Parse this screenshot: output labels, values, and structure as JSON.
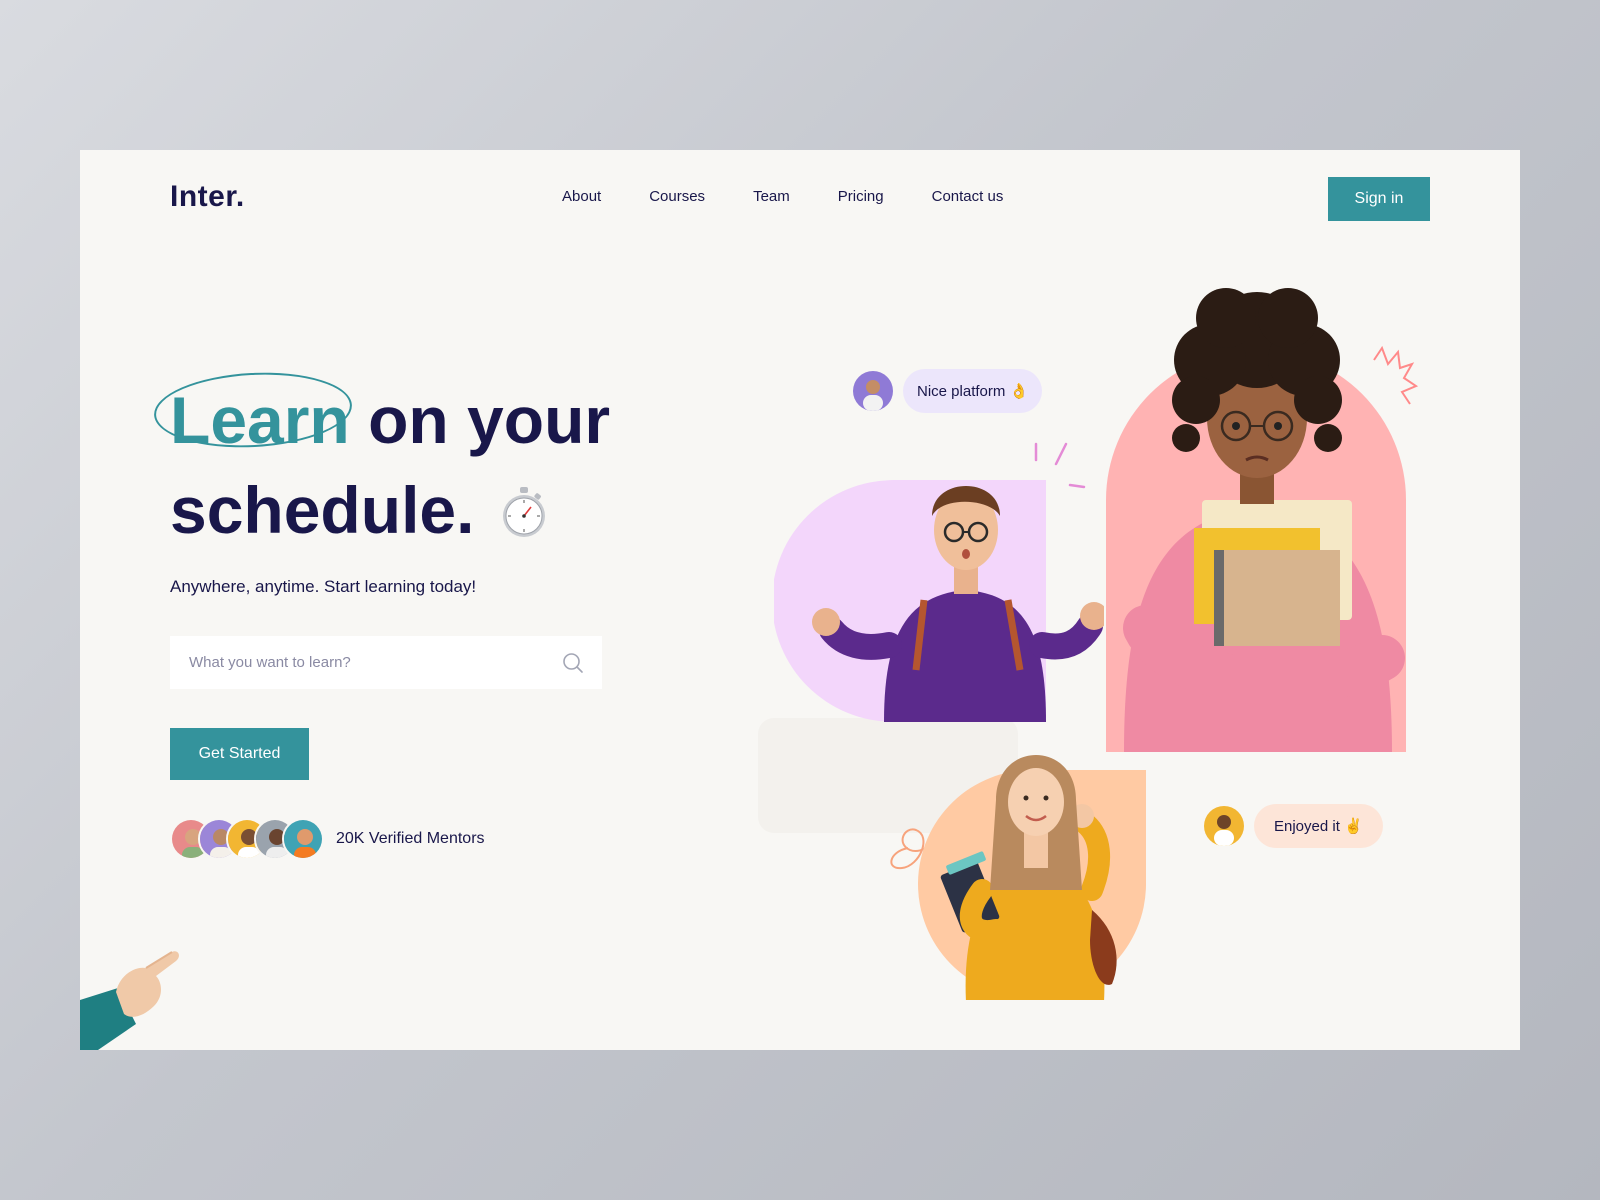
{
  "header": {
    "logo": "Inter.",
    "nav": [
      "About",
      "Courses",
      "Team",
      "Pricing",
      "Contact us"
    ],
    "signin_label": "Sign in"
  },
  "hero": {
    "headline_accent": "Learn",
    "headline_rest": "on your",
    "headline_line2": "schedule.",
    "subtitle": "Anywhere, anytime. Start learning today!",
    "search_placeholder": "What you want to learn?",
    "cta_label": "Get Started",
    "mentors_text": "20K Verified Mentors"
  },
  "testimonials": {
    "top": "Nice platform 👌",
    "bottom": "Enjoyed it ✌️"
  },
  "colors": {
    "primary": "#34939c",
    "navy": "#19174a",
    "background": "#f8f7f4",
    "lavender": "#f3d6fb",
    "pink": "#ffb3b3",
    "peach": "#ffcaa3",
    "bubble_top": "#ece6fb",
    "bubble_bottom": "#fde5d8"
  },
  "icons": [
    "stopwatch-icon",
    "search-icon",
    "pointing-hand-icon"
  ]
}
